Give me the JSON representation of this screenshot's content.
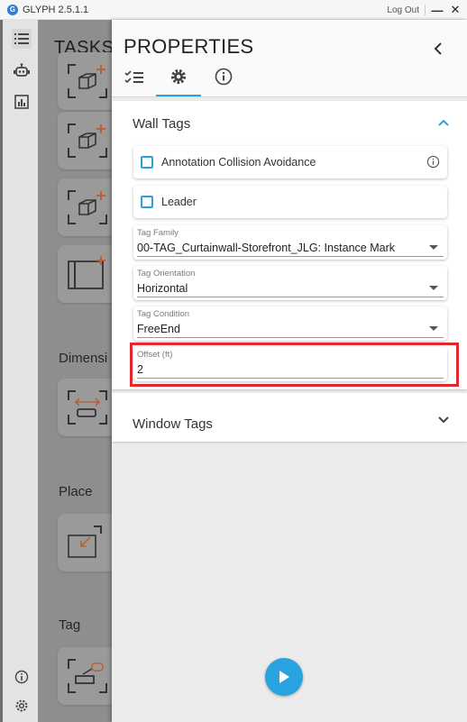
{
  "app": {
    "title": "GLYPH 2.5.1.1",
    "logo_letter": "G",
    "logout_label": "Log Out"
  },
  "sidebar": {
    "icons": [
      "list-icon",
      "robot-icon",
      "chart-icon"
    ],
    "bottom_icons": [
      "info-icon",
      "settings-icon"
    ]
  },
  "tasks": {
    "title": "TASKS",
    "sections": [
      {
        "label": "Dimensi"
      },
      {
        "label": "Place"
      },
      {
        "label": "Tag"
      }
    ]
  },
  "properties": {
    "title": "PROPERTIES",
    "tabs": [
      "checklist-tab",
      "settings-tab",
      "info-tab"
    ],
    "active_tab": "settings-tab",
    "wall_tags": {
      "title": "Wall Tags",
      "expanded": true,
      "annotation_collision": {
        "label": "Annotation Collision Avoidance",
        "checked": false
      },
      "leader": {
        "label": "Leader",
        "checked": false
      },
      "tag_family": {
        "label": "Tag Family",
        "value": "00-TAG_Curtainwall-Storefront_JLG: Instance Mark"
      },
      "tag_orientation": {
        "label": "Tag Orientation",
        "value": "Horizontal"
      },
      "tag_condition": {
        "label": "Tag Condition",
        "value": "FreeEnd"
      },
      "offset": {
        "label": "Offset (ft)",
        "value": "2"
      }
    },
    "window_tags": {
      "title": "Window Tags",
      "expanded": false
    }
  },
  "colors": {
    "accent": "#29a3e0",
    "highlight": "#e0282d",
    "task_icon_plus": "#b5623a"
  }
}
